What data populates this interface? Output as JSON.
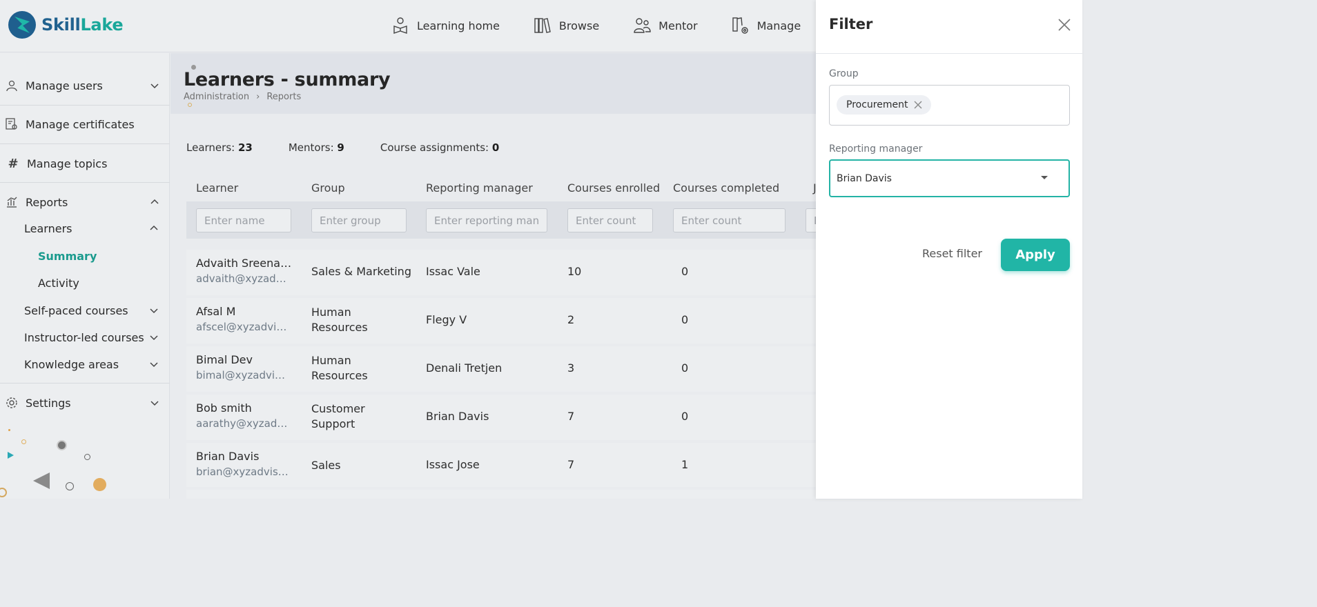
{
  "brand": {
    "part1": "Skill",
    "part2": "Lake",
    "color_primary": "#21628f",
    "color_accent": "#1aa79a"
  },
  "topnav": [
    {
      "label": "Learning home",
      "icon": "learner-icon"
    },
    {
      "label": "Browse",
      "icon": "books-icon"
    },
    {
      "label": "Mentor",
      "icon": "mentor-icon"
    },
    {
      "label": "Manage",
      "icon": "manage-settings-icon"
    }
  ],
  "sidebar": {
    "manage_users": "Manage users",
    "manage_certificates": "Manage certificates",
    "manage_topics": "Manage topics",
    "reports": "Reports",
    "learners": "Learners",
    "summary": "Summary",
    "activity": "Activity",
    "self_paced": "Self-paced courses",
    "instructor_led": "Instructor-led courses",
    "knowledge_areas": "Knowledge areas",
    "settings": "Settings"
  },
  "page": {
    "title": "Learners - summary",
    "breadcrumb": [
      "Administration",
      "›",
      "Reports"
    ]
  },
  "stats": {
    "learners_label": "Learners:",
    "learners_value": "23",
    "mentors_label": "Mentors:",
    "mentors_value": "9",
    "assignments_label": "Course assignments:",
    "assignments_value": "0"
  },
  "table": {
    "headers": [
      "Learner",
      "Group",
      "Reporting manager",
      "Courses enrolled",
      "Courses completed",
      "J"
    ],
    "placeholders": [
      "Enter name",
      "Enter group",
      "Enter reporting manager",
      "Enter count",
      "Enter count",
      "E"
    ],
    "rows": [
      {
        "name": "Advaith Sreenadh",
        "email": "advaith@xyzadvisors.com",
        "group": "Sales & Marketing",
        "manager": "Issac Vale",
        "enrolled": "10",
        "completed": "0"
      },
      {
        "name": "Afsal M",
        "email": "afscel@xyzadvisors.com",
        "group": "Human Resources",
        "manager": "Flegy V",
        "enrolled": "2",
        "completed": "0"
      },
      {
        "name": "Bimal Dev",
        "email": "bimal@xyzadvisors.com",
        "group": "Human Resources",
        "manager": "Denali Tretjen",
        "enrolled": "3",
        "completed": "0"
      },
      {
        "name": "Bob smith",
        "email": "aarathy@xyzadvisors.com",
        "group": "Customer Support",
        "manager": "Brian Davis",
        "enrolled": "7",
        "completed": "0"
      },
      {
        "name": "Brian Davis",
        "email": "brian@xyzadvisors.com",
        "group": "Sales",
        "manager": "Issac Jose",
        "enrolled": "7",
        "completed": "1"
      }
    ]
  },
  "filter": {
    "title": "Filter",
    "group_label": "Group",
    "group_chip": "Procurement",
    "manager_label": "Reporting manager",
    "manager_value": "Brian Davis",
    "reset": "Reset filter",
    "apply": "Apply",
    "accent": "#21b5a6"
  }
}
